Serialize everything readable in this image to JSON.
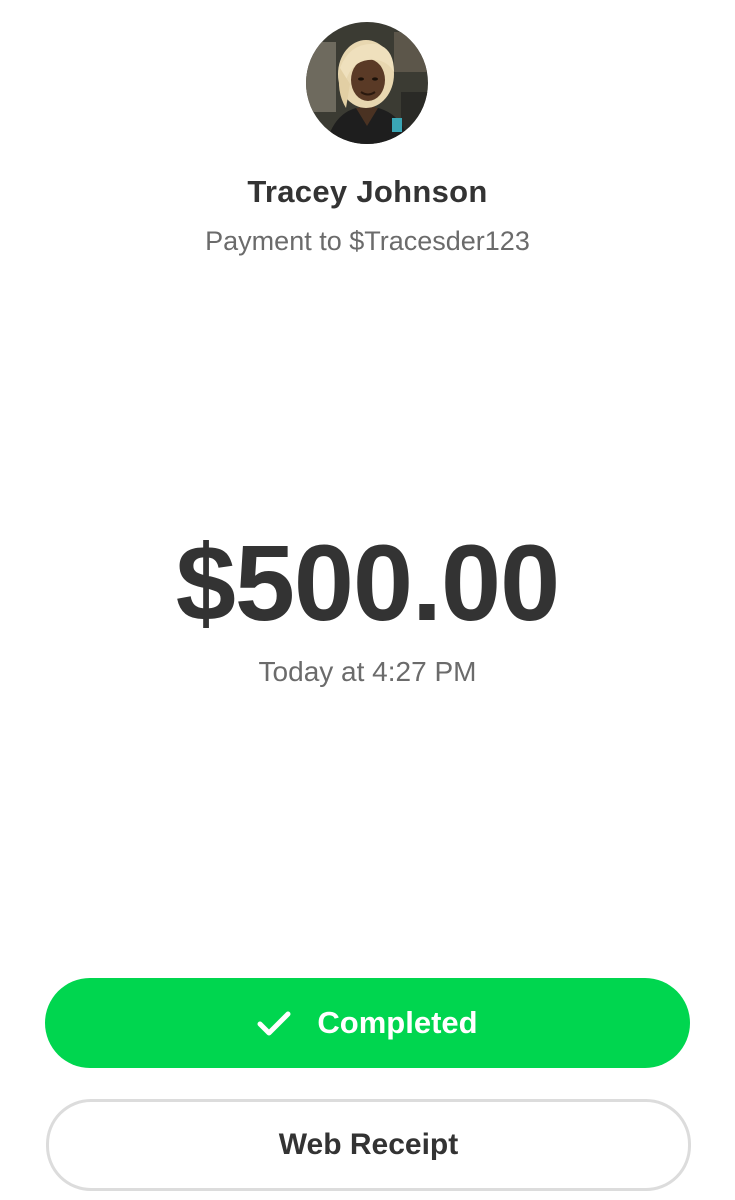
{
  "recipient": {
    "name": "Tracey Johnson",
    "subtitle": "Payment to $Tracesder123"
  },
  "payment": {
    "amount": "$500.00",
    "timestamp": "Today at 4:27 PM"
  },
  "actions": {
    "completed_label": "Completed",
    "completed_icon": "checkmark-icon",
    "receipt_label": "Web Receipt"
  },
  "colors": {
    "accent_green": "#00d64f",
    "text_primary": "#333333",
    "text_secondary": "#6b6b6b"
  }
}
